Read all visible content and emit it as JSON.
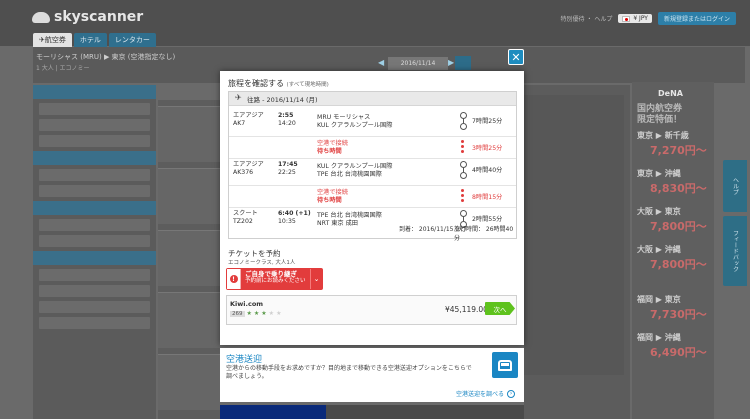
{
  "header": {
    "logo": "skyscanner",
    "links": "特別優待 ・ ヘルプ",
    "currency": "¥ JPY",
    "login_button": "新規登録またはログイン",
    "tabs": [
      {
        "label": "✈航空券"
      },
      {
        "label": "ホテル"
      },
      {
        "label": "レンタカー"
      }
    ]
  },
  "search": {
    "route": "モーリシャス (MRU) ▶ 東京 (空港指定なし)",
    "route_sub": "1 大人 | エコノミー",
    "date": "2016/11/14"
  },
  "modal": {
    "title": "旅程を確認する",
    "title_note": "(すべて現地時間)",
    "segment_header": "往路 - 2016/11/14 (月)",
    "legs": [
      {
        "airline": "エアアジア",
        "flight": "AK7",
        "dep_time": "2:55",
        "arr_time": "14:20",
        "dep_airport": "MRU モーリシャス",
        "arr_airport": "KUL クアラルンプール国際",
        "duration": "7時間25分"
      },
      {
        "airline": "エアアジア",
        "flight": "AK376",
        "dep_time": "17:45",
        "arr_time": "22:25",
        "dep_airport": "KUL クアラルンプール国際",
        "arr_airport": "TPE 台北 台湾桃園国際",
        "duration": "4時間40分"
      },
      {
        "airline": "スクート",
        "flight": "TZ202",
        "dep_time": "6:40 (+1)",
        "arr_time": "10:35",
        "dep_airport": "TPE 台北 台湾桃園国際",
        "arr_airport": "NRT 東京 成田",
        "duration": "2時間55分"
      }
    ],
    "layovers": [
      {
        "line1": "空港で接続",
        "line2": "待ち時間",
        "duration": "3時間25分"
      },
      {
        "line1": "空港で接続",
        "line2": "待ち時間",
        "duration": "8時間15分"
      }
    ],
    "arrival": "到着： 2016/11/15 (火)",
    "total_duration": "旅行時間： 26時間40分",
    "booking_title": "チケットを予約",
    "booking_sub": "エコノミークラス, 大人1人",
    "warning_line1": "ご自身で乗り継ぎ",
    "warning_line2": "予約前にお読みください",
    "offer": {
      "provider": "Kiwi.com",
      "review_count": "269",
      "rating": 2.5,
      "price": "¥45,119.00",
      "next_label": "次へ"
    }
  },
  "transfer": {
    "title": "空港送迎",
    "text": "空港からの移動手段をお求めですか？目的地まで移動できる空港送迎オプションをこちらで調べましょう。",
    "link": "空港送迎を調べる"
  },
  "ad": {
    "brand": "DeNA",
    "title_line1": "国内航空券",
    "title_line2": "限定特価！",
    "routes": [
      {
        "route": "東京 ▶ 新千歳",
        "price": "7,270円～"
      },
      {
        "route": "東京 ▶ 沖縄",
        "price": "8,830円～"
      },
      {
        "route": "大阪 ▶ 東京",
        "price": "7,800円～"
      },
      {
        "route": "大阪 ▶ 沖縄",
        "price": "7,800円～"
      },
      {
        "route": "福岡 ▶ 東京",
        "price": "7,730円～"
      },
      {
        "route": "福岡 ▶ 沖縄",
        "price": "6,490円～"
      }
    ]
  },
  "side_tabs": {
    "help": "ヘルプ",
    "feedback": "フィードバック"
  }
}
